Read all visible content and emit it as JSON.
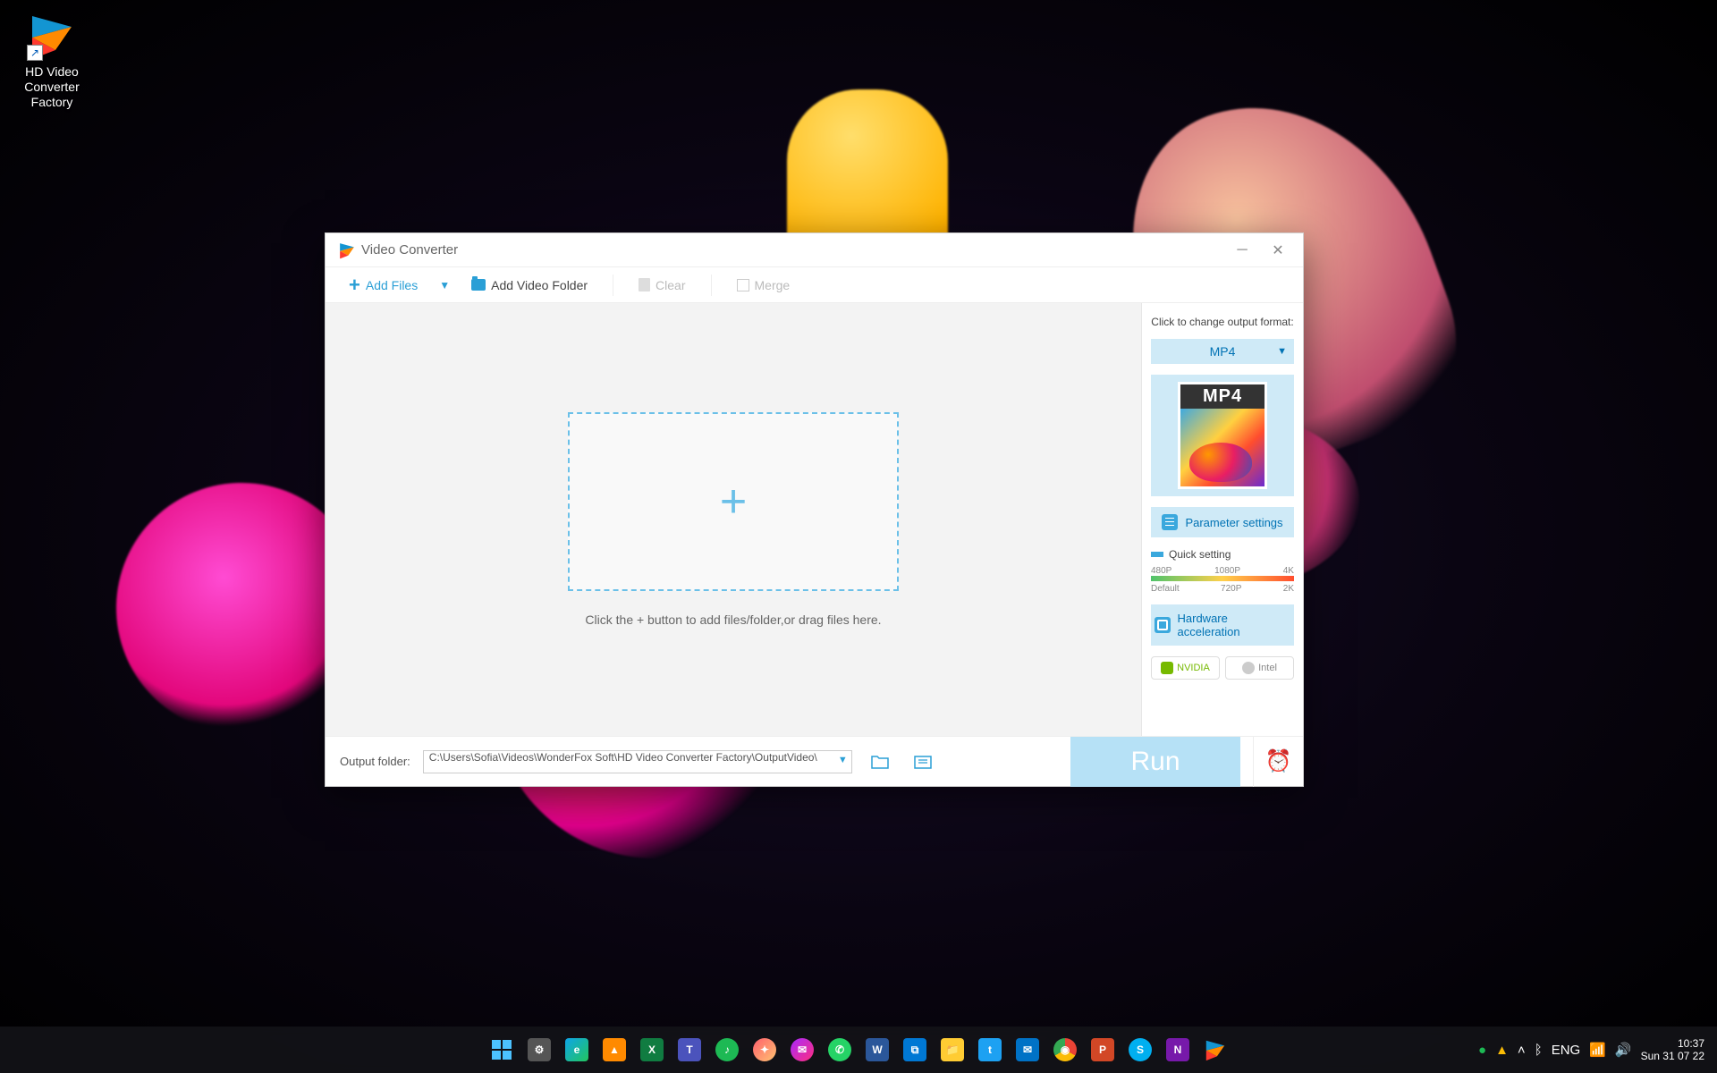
{
  "desktop": {
    "icon_label": "HD Video Converter Factory"
  },
  "window": {
    "title": "Video Converter",
    "toolbar": {
      "add_files": "Add Files",
      "add_folder": "Add Video Folder",
      "clear": "Clear",
      "merge": "Merge"
    },
    "dropzone_hint": "Click the + button to add files/folder,or drag files here.",
    "sidebar": {
      "output_format_label": "Click to change output format:",
      "format": "MP4",
      "thumb_badge": "MP4",
      "param_settings": "Parameter settings",
      "quick_setting": "Quick setting",
      "ticks_top": [
        "480P",
        "1080P",
        "4K"
      ],
      "ticks_bot": [
        "Default",
        "720P",
        "2K"
      ],
      "hw_accel": "Hardware acceleration",
      "gpu_nvidia": "NVIDIA",
      "gpu_intel": "Intel"
    },
    "bottom": {
      "out_label": "Output folder:",
      "out_path": "C:\\Users\\Sofia\\Videos\\WonderFox Soft\\HD Video Converter Factory\\OutputVideo\\",
      "run": "Run"
    }
  },
  "taskbar": {
    "lang": "ENG",
    "time": "10:37",
    "date": "Sun 31 07 22"
  }
}
